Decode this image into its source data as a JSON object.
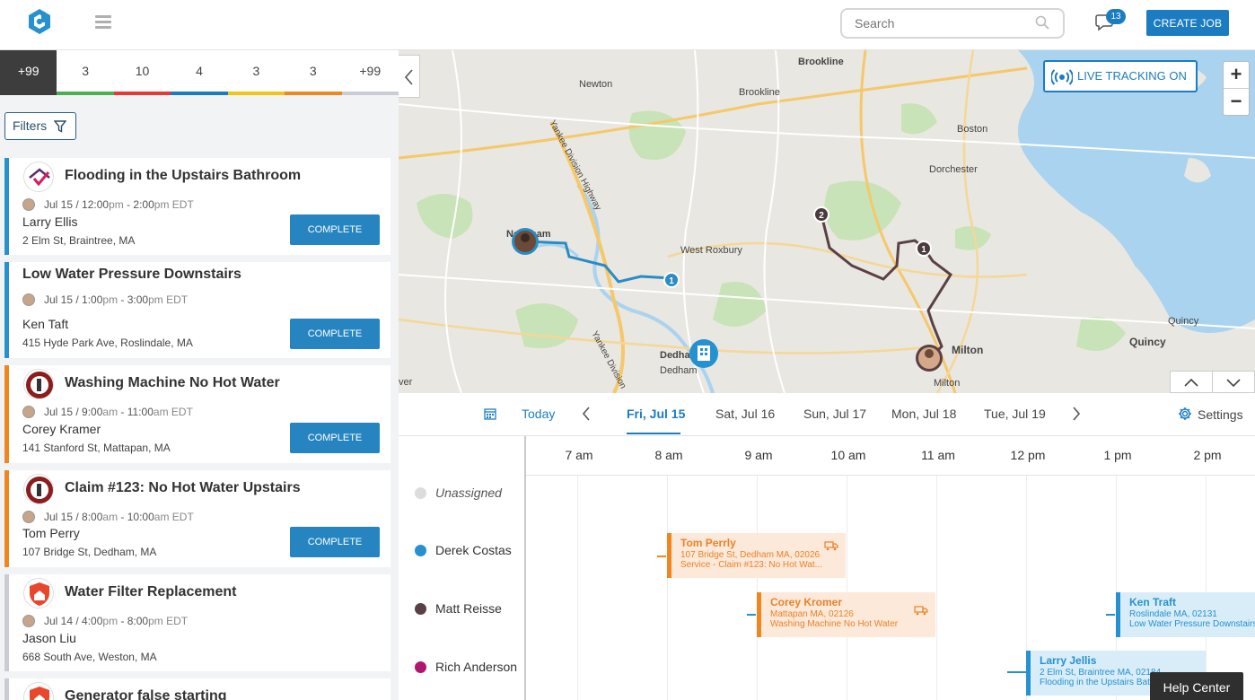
{
  "header": {
    "search_placeholder": "Search",
    "notifications_count": "13",
    "create_job_label": "CREATE JOB"
  },
  "status_counts": [
    {
      "label": "+99",
      "color": "#3d3d3d"
    },
    {
      "label": "3",
      "color": "#4caf50"
    },
    {
      "label": "10",
      "color": "#e53935"
    },
    {
      "label": "4",
      "color": "#1c7cc1"
    },
    {
      "label": "3",
      "color": "#f0c419"
    },
    {
      "label": "3",
      "color": "#f0861f"
    },
    {
      "label": "+99",
      "color": "#c9cdd3"
    }
  ],
  "filters_label": "Filters",
  "jobs": [
    {
      "title": "Flooding in the Upstairs Bathroom",
      "date": "Jul 15",
      "start": "12:00",
      "start_ampm": "pm",
      "end": "2:00",
      "end_ampm": "pm",
      "tz": "EDT",
      "customer": "Larry Ellis",
      "address": "2 Elm St, Braintree, MA",
      "button": "COMPLETE",
      "icon": "house-check-icon",
      "accent": "#2591cf"
    },
    {
      "title": "Low Water Pressure Downstairs",
      "date": "Jul 15",
      "start": "1:00",
      "start_ampm": "pm",
      "end": "3:00",
      "end_ampm": "pm",
      "tz": "EDT",
      "customer": "Ken Taft",
      "address": "415 Hyde Park Ave, Roslindale, MA",
      "button": "COMPLETE",
      "icon": "",
      "accent": "#2591cf"
    },
    {
      "title": "Washing Machine No Hot Water",
      "date": "Jul 15",
      "start": "9:00",
      "start_ampm": "am",
      "end": "11:00",
      "end_ampm": "am",
      "tz": "EDT",
      "customer": "Corey Kramer",
      "address": "141 Stanford St, Mattapan, MA",
      "button": "COMPLETE",
      "icon": "company-logo-icon",
      "accent": "#f0861f"
    },
    {
      "title": "Claim #123: No Hot Water Upstairs",
      "date": "Jul 15",
      "start": "8:00",
      "start_ampm": "am",
      "end": "10:00",
      "end_ampm": "am",
      "tz": "EDT",
      "customer": "Tom Perry",
      "address": "107 Bridge St, Dedham, MA",
      "button": "COMPLETE",
      "icon": "company-logo-icon",
      "accent": "#f0861f"
    },
    {
      "title": "Water Filter Replacement",
      "date": "Jul 14",
      "start": "4:00",
      "start_ampm": "pm",
      "end": "8:00",
      "end_ampm": "pm",
      "tz": "EDT",
      "customer": "Jason Liu",
      "address": "668 South Ave, Weston, MA",
      "button": "",
      "icon": "shield-house-icon",
      "accent": "#c9cdd3"
    },
    {
      "title": "Generator false starting",
      "icon": "shield-house-icon",
      "accent": "#c9cdd3"
    }
  ],
  "map": {
    "live_tracking_label": "LIVE TRACKING ON",
    "zoom_in": "+",
    "zoom_out": "−",
    "places": [
      "Brookline",
      "Newton",
      "Brookline",
      "Boston",
      "Dorchester",
      "Needham",
      "West Roxbury",
      "Quincy",
      "Quincy",
      "Dedham",
      "Dedham",
      "Milton",
      "Milton",
      "Yankee Division Highway",
      "Yankee Division",
      "ver"
    ],
    "markers": [
      "1",
      "2",
      "1"
    ]
  },
  "schedule": {
    "today_label": "Today",
    "days": [
      "Fri, Jul 15",
      "Sat, Jul 16",
      "Sun, Jul 17",
      "Mon, Jul 18",
      "Tue, Jul 19"
    ],
    "selected_day": "Fri, Jul 15",
    "settings_label": "Settings",
    "hours": [
      "7 am",
      "8 am",
      "9 am",
      "10 am",
      "11 am",
      "12 pm",
      "1 pm",
      "2 pm"
    ],
    "technicians": [
      {
        "name": "Unassigned",
        "color": "#dcdcdc"
      },
      {
        "name": "Derek Costas",
        "color": "#2591cf"
      },
      {
        "name": "Matt Reisse",
        "color": "#5a4045"
      },
      {
        "name": "Rich Anderson",
        "color": "#b0166e"
      }
    ],
    "events": [
      {
        "name": "Tom Perrly",
        "line1": "107 Bridge St, Dedham MA, 02026",
        "line2": "Service - Claim #123: No Hot Wat..."
      },
      {
        "name": "Corey Kromer",
        "line1": "Mattapan MA, 02126",
        "line2": "Washing Machine No Hot Water"
      },
      {
        "name": "Ken Traft",
        "line1": "Roslindale MA, 02131",
        "line2": "Low Water Pressure Downstairs"
      },
      {
        "name": "Larry Jellis",
        "line1": "2 Elm St, Braintree MA, 02184",
        "line2": "Flooding in the Upstairs Bathroom"
      }
    ]
  },
  "help_center_label": "Help Center"
}
